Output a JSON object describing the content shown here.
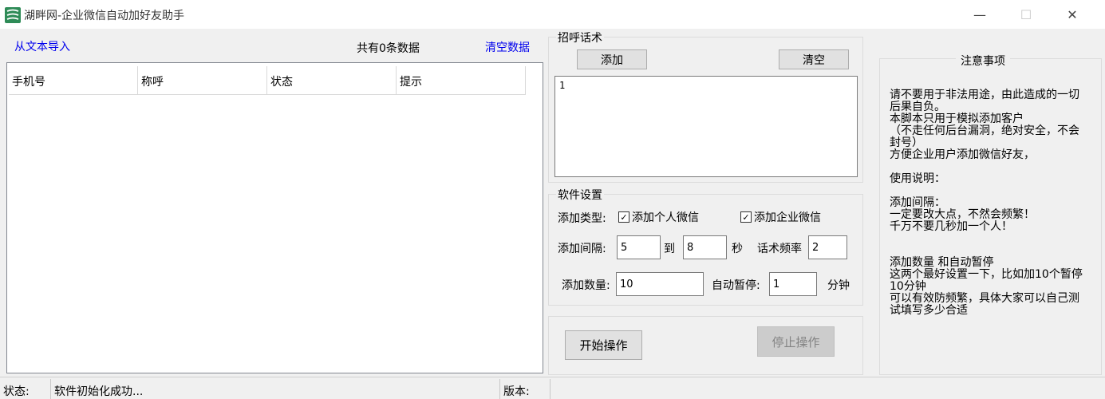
{
  "window": {
    "title": "湖畔网-企业微信自动加好友助手",
    "icon": "app-logo-icon",
    "minimize_glyph": "—",
    "maximize_glyph": "☐",
    "close_glyph": "✕"
  },
  "left": {
    "import_label": "从文本导入",
    "count_text": "共有0条数据",
    "clear_label": "清空数据",
    "columns": [
      "手机号",
      "称呼",
      "状态",
      "提示"
    ]
  },
  "greeting": {
    "title": "招呼话术",
    "add_label": "添加",
    "clear_label": "清空",
    "content": "1"
  },
  "settings": {
    "title": "软件设置",
    "add_type_label": "添加类型:",
    "personal_wechat_label": "添加个人微信",
    "personal_checked": true,
    "enterprise_wechat_label": "添加企业微信",
    "enterprise_checked": true,
    "interval_label": "添加间隔:",
    "interval_from": "5",
    "to_label": "到",
    "interval_to": "8",
    "seconds_label": "秒",
    "freq_label": "话术频率",
    "freq_value": "2",
    "quantity_label": "添加数量:",
    "quantity_value": "10",
    "pause_label": "自动暂停:",
    "pause_value": "1",
    "minutes_label": "分钟"
  },
  "actions": {
    "start_label": "开始操作",
    "stop_label": "停止操作"
  },
  "notice": {
    "title": "注意事项",
    "body": "请不要用于非法用途，由此造成的一切后果自负。\n本脚本只用于模拟添加客户\n（不走任何后台漏洞，绝对安全，不会封号）\n方便企业用户添加微信好友，\n\n使用说明：\n\n添加间隔：\n一定要改大点，不然会频繁！\n千万不要几秒加一个人！\n\n\n添加数量 和自动暂停\n这两个最好设置一下，比如加10个暂停10分钟\n可以有效防频繁，具体大家可以自己测试填写多少合适"
  },
  "status": {
    "status_label": "状态:",
    "status_text": "软件初始化成功...",
    "version_label": "版本:"
  },
  "colors": {
    "link": "#0000ee",
    "window_bg": "#f0f0f0",
    "icon_green": "#2e8b57"
  }
}
